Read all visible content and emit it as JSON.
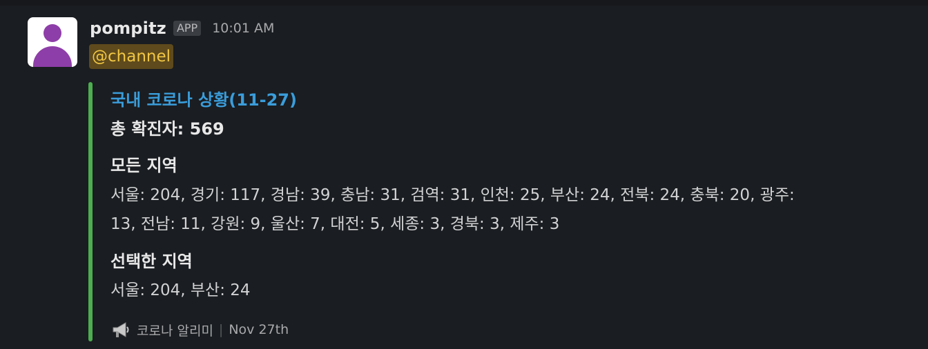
{
  "message": {
    "sender": "pompitz",
    "badge": "APP",
    "time": "10:01 AM",
    "mention": "@channel"
  },
  "attachment": {
    "title": "국내 코로나 상황(11-27)",
    "total": "총 확진자: 569",
    "all_regions_title": "모든 지역",
    "all_regions_line1": "서울: 204, 경기: 117, 경남: 39, 충남: 31, 검역: 31, 인천: 25, 부산: 24, 전북: 24, 충북: 20, 광주:",
    "all_regions_line2": "13, 전남: 11, 강원: 9, 울산: 7, 대전: 5, 세종: 3, 경북: 3, 제주: 3",
    "selected_regions_title": "선택한 지역",
    "selected_regions": "서울: 204, 부산: 24",
    "footer_source": "코로나 알리미",
    "footer_separator": "|",
    "footer_date": "Nov 27th",
    "accent_color": "#4cae4f",
    "footer_icon": "megaphone-icon"
  }
}
